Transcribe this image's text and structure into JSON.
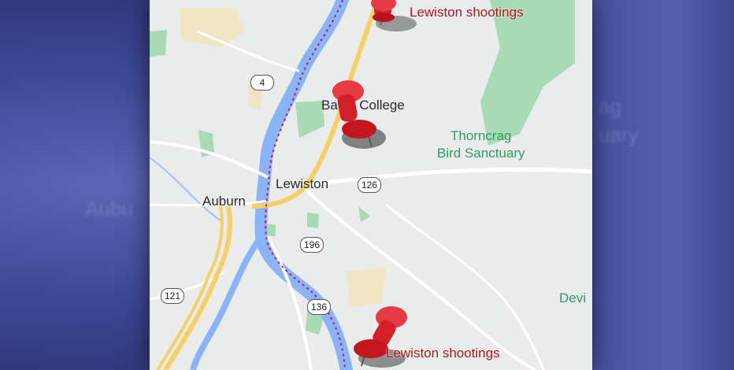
{
  "background": {
    "colors": {
      "frame": "#3f4a8f",
      "map_land": "#eaecec",
      "water": "#8ab4f8",
      "park": "#a8dab5",
      "highway": "#f6cf65",
      "pin": "#d21f2a",
      "label_red": "#b4121b",
      "park_text": "#2f9a62"
    },
    "ghost_left": "Aubu",
    "ghost_right_top": "ag",
    "ghost_right_mid": "uary"
  },
  "map": {
    "places": {
      "lewiston": "Lewiston",
      "auburn": "Auburn",
      "bates_college": "Bates College",
      "sanctuary_line1": "Thorncrag",
      "sanctuary_line2": "Bird Sanctuary",
      "devil": "Devi"
    },
    "routes": {
      "r4": "4",
      "r126": "126",
      "r196": "196",
      "r121": "121",
      "r136": "136"
    },
    "pins": [
      {
        "name": "pin-top",
        "label": "Lewiston shootings",
        "icon": "pushpin-icon"
      },
      {
        "name": "pin-middle",
        "label": "",
        "icon": "pushpin-icon"
      },
      {
        "name": "pin-bottom",
        "label": "Lewiston shootings",
        "icon": "pushpin-icon"
      }
    ]
  }
}
